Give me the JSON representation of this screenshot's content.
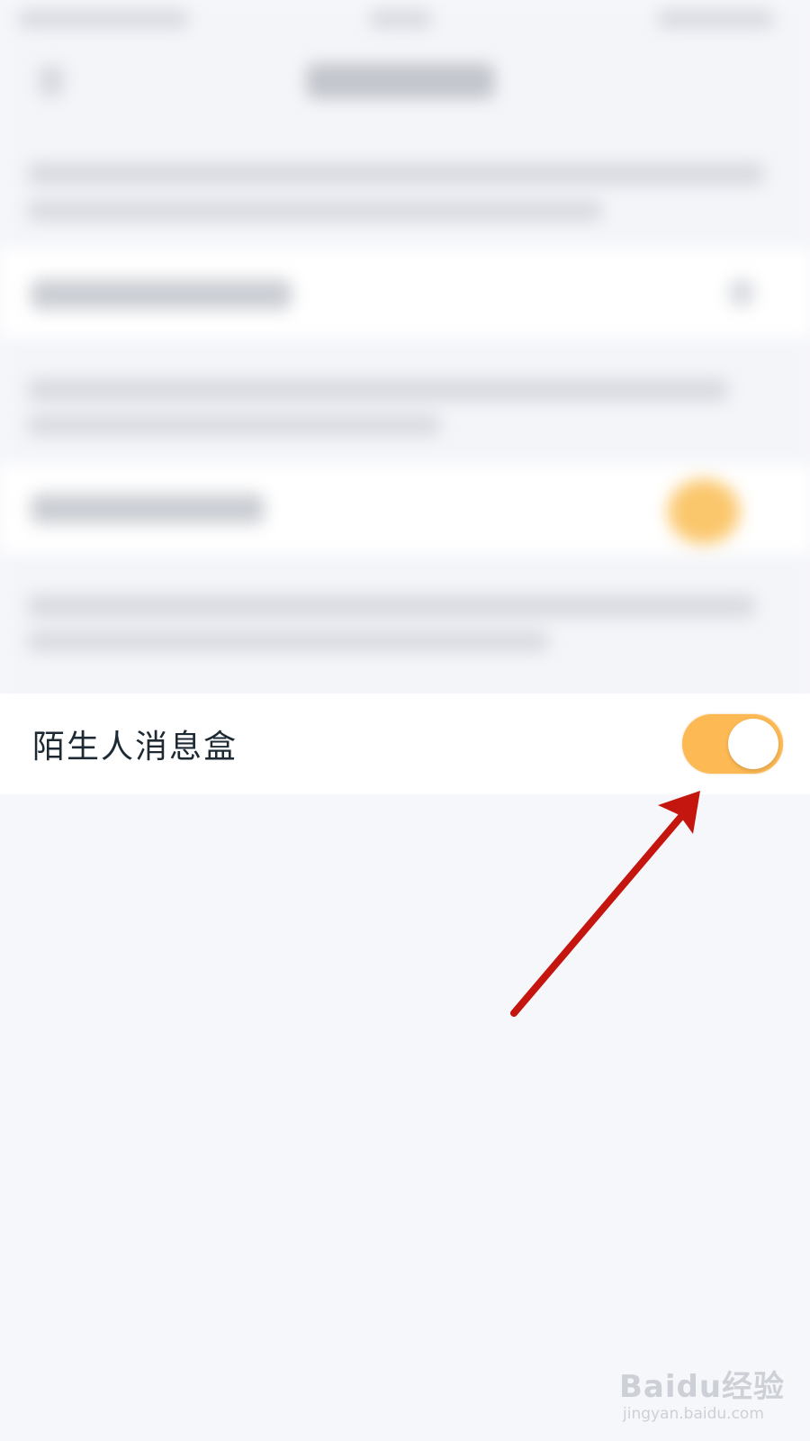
{
  "setting": {
    "label": "陌生人消息盒",
    "toggle_on": true
  },
  "colors": {
    "toggle_on": "#fcb954",
    "arrow": "#c4160f",
    "page_background": "#f6f7fb"
  },
  "watermark": {
    "brand": "Baidu经验",
    "url": "jingyan.baidu.com"
  }
}
